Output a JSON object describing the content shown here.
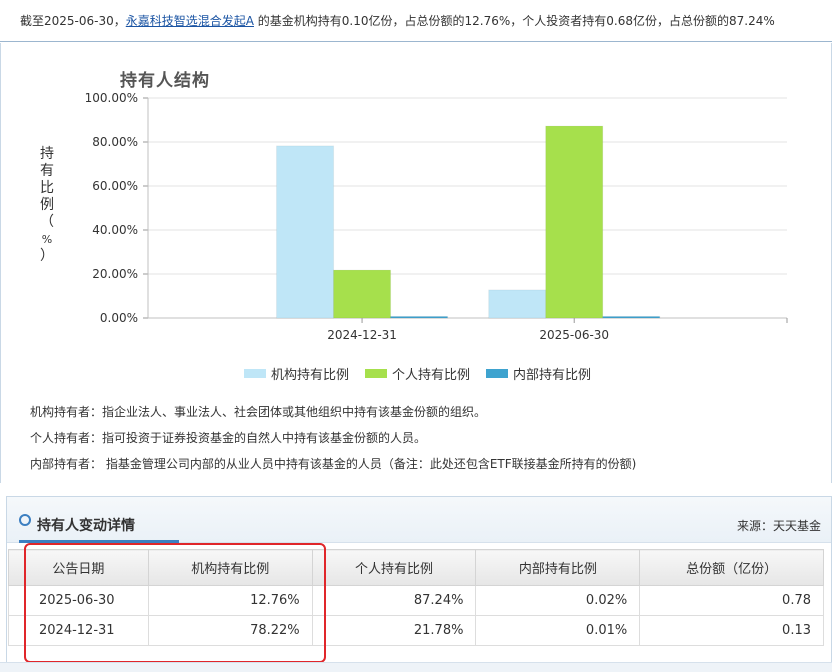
{
  "summary": {
    "prefix": "截至2025-06-30，",
    "fund_link": "永嘉科技智选混合发起A",
    "suffix": " 的基金机构持有0.10亿份，占总份额的12.76%，个人投资者持有0.68亿份，占总份额的87.24%"
  },
  "chart_title": "持有人结构",
  "ylabel_chars": [
    "持",
    "有",
    "比",
    "例",
    "（",
    "%",
    "）"
  ],
  "chart_data": {
    "type": "bar",
    "title": "持有人结构",
    "ylabel": "持有比例（%）",
    "categories": [
      "2024-12-31",
      "2025-06-30"
    ],
    "ylim": [
      0,
      100
    ],
    "yticks": [
      "0.00%",
      "20.00%",
      "40.00%",
      "60.00%",
      "80.00%",
      "100.00%"
    ],
    "legend_position": "bottom",
    "series": [
      {
        "name": "机构持有比例",
        "values": [
          78.22,
          12.76
        ],
        "color": "#bfe6f7"
      },
      {
        "name": "个人持有比例",
        "values": [
          21.78,
          87.24
        ],
        "color": "#a6e04c"
      },
      {
        "name": "内部持有比例",
        "values": [
          0.01,
          0.02
        ],
        "color": "#3ea3cf"
      }
    ]
  },
  "descriptions": [
    "机构持有者：指企业法人、事业法人、社会团体或其他组织中持有该基金份额的组织。",
    "个人持有者：指可投资于证券投资基金的自然人中持有该基金份额的人员。",
    "内部持有者： 指基金管理公司内部的从业人员中持有该基金的人员（备注：此处还包含ETF联接基金所持有的份额)"
  ],
  "section": {
    "title": "持有人变动详情",
    "source": "来源：天天基金"
  },
  "table": {
    "headers": [
      "公告日期",
      "机构持有比例",
      "个人持有比例",
      "内部持有比例",
      "总份额（亿份）"
    ],
    "rows": [
      [
        "2025-06-30",
        "12.76%",
        "87.24%",
        "0.02%",
        "0.78"
      ],
      [
        "2024-12-31",
        "78.22%",
        "21.78%",
        "0.01%",
        "0.13"
      ]
    ]
  },
  "colors": {
    "link": "#1b54a3",
    "accent": "#3c7fc1",
    "highlight_box": "#e0262a"
  }
}
